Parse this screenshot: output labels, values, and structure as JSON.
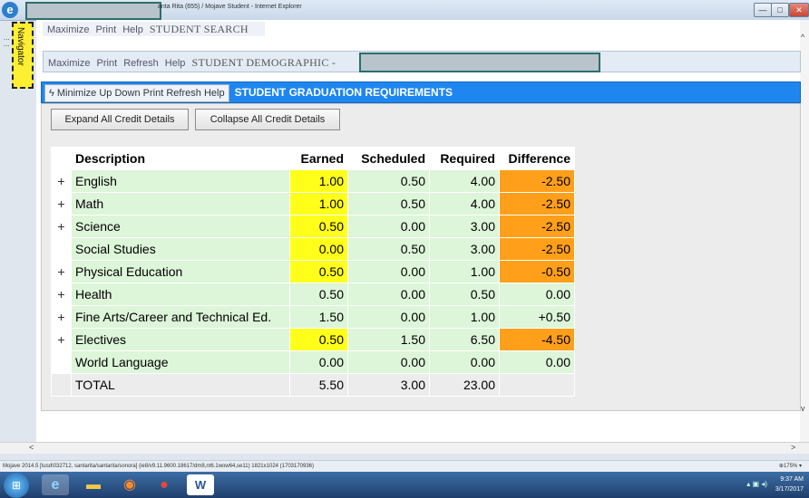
{
  "window": {
    "title": "anta Rita (655) / Mojave Student - Internet Explorer",
    "minimize": "—",
    "maximize": "□",
    "close": "✕"
  },
  "navigator": {
    "label": "Navigator"
  },
  "search_bar": {
    "links": [
      "Maximize",
      "Print",
      "Help"
    ],
    "title": "STUDENT SEARCH"
  },
  "demographic_bar": {
    "links": [
      "Maximize",
      "Print",
      "Refresh",
      "Help"
    ],
    "title": "STUDENT DEMOGRAPHIC -"
  },
  "graduation_bar": {
    "links": [
      "Minimize",
      "Up",
      "Down",
      "Print",
      "Refresh",
      "Help"
    ],
    "title": "STUDENT GRADUATION REQUIREMENTS"
  },
  "buttons": {
    "expand": "Expand All Credit Details",
    "collapse": "Collapse All Credit Details"
  },
  "table": {
    "headers": [
      "Description",
      "Earned",
      "Scheduled",
      "Required",
      "Difference"
    ],
    "rows": [
      {
        "exp": "+",
        "desc": "English",
        "earned": "1.00",
        "scheduled": "0.50",
        "required": "4.00",
        "difference": "-2.50"
      },
      {
        "exp": "+",
        "desc": "Math",
        "earned": "1.00",
        "scheduled": "0.50",
        "required": "4.00",
        "difference": "-2.50"
      },
      {
        "exp": "+",
        "desc": "Science",
        "earned": "0.50",
        "scheduled": "0.00",
        "required": "3.00",
        "difference": "-2.50"
      },
      {
        "exp": "",
        "desc": "Social Studies",
        "earned": "0.00",
        "scheduled": "0.50",
        "required": "3.00",
        "difference": "-2.50"
      },
      {
        "exp": "+",
        "desc": "Physical Education",
        "earned": "0.50",
        "scheduled": "0.00",
        "required": "1.00",
        "difference": "-0.50"
      },
      {
        "exp": "+",
        "desc": "Health",
        "earned": "0.50",
        "scheduled": "0.00",
        "required": "0.50",
        "difference": "0.00"
      },
      {
        "exp": "+",
        "desc": "Fine Arts/Career and Technical Ed.",
        "earned": "1.50",
        "scheduled": "0.00",
        "required": "1.00",
        "difference": "+0.50"
      },
      {
        "exp": "+",
        "desc": "Electives",
        "earned": "0.50",
        "scheduled": "1.50",
        "required": "6.50",
        "difference": "-4.50"
      },
      {
        "exp": "",
        "desc": "World Language",
        "earned": "0.00",
        "scheduled": "0.00",
        "required": "0.00",
        "difference": "0.00"
      }
    ],
    "total": {
      "desc": "TOTAL",
      "earned": "5.50",
      "scheduled": "3.00",
      "required": "23.00",
      "difference": ""
    }
  },
  "colors": {
    "row_bg": "#ddf5d9",
    "earned_deficit": "#ffff1a",
    "difference_deficit": "#ff9f1a",
    "header_bar": "#1f86f0"
  },
  "statusbar": {
    "text": "Mojave 2014.5 [tusd\\032712, santarita/santarita/sonora] (ie8/v9.11.9600.18617/dm8,nt6.1wow64,se11) 1821x1024 (1703170936)",
    "zoom": "175%"
  },
  "taskbar": {
    "time": "9:37 AM",
    "date": "3/17/2017"
  },
  "icons": {
    "ie": "internet-explorer-icon",
    "folder": "folder-icon",
    "media": "media-player-icon",
    "chrome": "chrome-icon",
    "word": "word-icon"
  }
}
